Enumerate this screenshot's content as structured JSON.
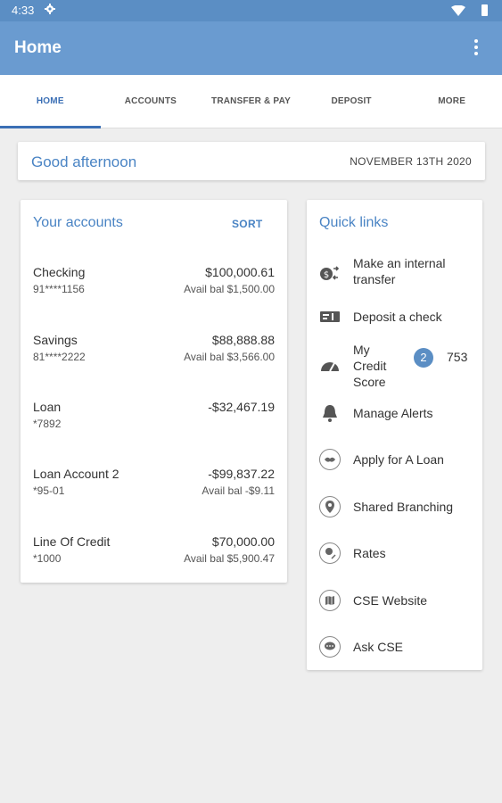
{
  "status_bar": {
    "time": "4:33"
  },
  "app_bar": {
    "title": "Home"
  },
  "tabs": [
    {
      "label": "HOME"
    },
    {
      "label": "ACCOUNTS"
    },
    {
      "label": "TRANSFER & PAY"
    },
    {
      "label": "DEPOSIT"
    },
    {
      "label": "MORE"
    }
  ],
  "greeting": {
    "text": "Good afternoon",
    "date": "NOVEMBER 13TH 2020"
  },
  "accounts": {
    "title": "Your accounts",
    "sort_label": "SORT",
    "items": [
      {
        "name": "Checking",
        "number": "91****1156",
        "balance": "$100,000.61",
        "avail": "Avail bal $1,500.00"
      },
      {
        "name": "Savings",
        "number": "81****2222",
        "balance": "$88,888.88",
        "avail": "Avail bal $3,566.00"
      },
      {
        "name": "Loan",
        "number": "*7892",
        "balance": "-$32,467.19",
        "avail": ""
      },
      {
        "name": "Loan Account 2",
        "number": "*95-01",
        "balance": "-$99,837.22",
        "avail": "Avail bal -$9.11"
      },
      {
        "name": "Line Of Credit",
        "number": "*1000",
        "balance": "$70,000.00",
        "avail": "Avail bal $5,900.47"
      }
    ]
  },
  "quick_links": {
    "title": "Quick links",
    "items": [
      {
        "label": "Make an internal transfer",
        "icon": "transfer-icon"
      },
      {
        "label": "Deposit a check",
        "icon": "check-deposit-icon"
      },
      {
        "label": "My Credit Score",
        "icon": "gauge-icon",
        "badge": "2",
        "score": "753"
      },
      {
        "label": "Manage Alerts",
        "icon": "bell-icon"
      },
      {
        "label": "Apply for A Loan",
        "icon": "handshake-icon"
      },
      {
        "label": "Shared Branching",
        "icon": "location-pin-icon"
      },
      {
        "label": "Rates",
        "icon": "rates-icon"
      },
      {
        "label": "CSE Website",
        "icon": "map-icon"
      },
      {
        "label": "Ask CSE",
        "icon": "chat-icon"
      }
    ]
  },
  "colors": {
    "app_bar": "#6a9bd0",
    "status_bar": "#5b8ec4",
    "accent": "#3b6fb5",
    "link_text": "#4a84c4"
  }
}
